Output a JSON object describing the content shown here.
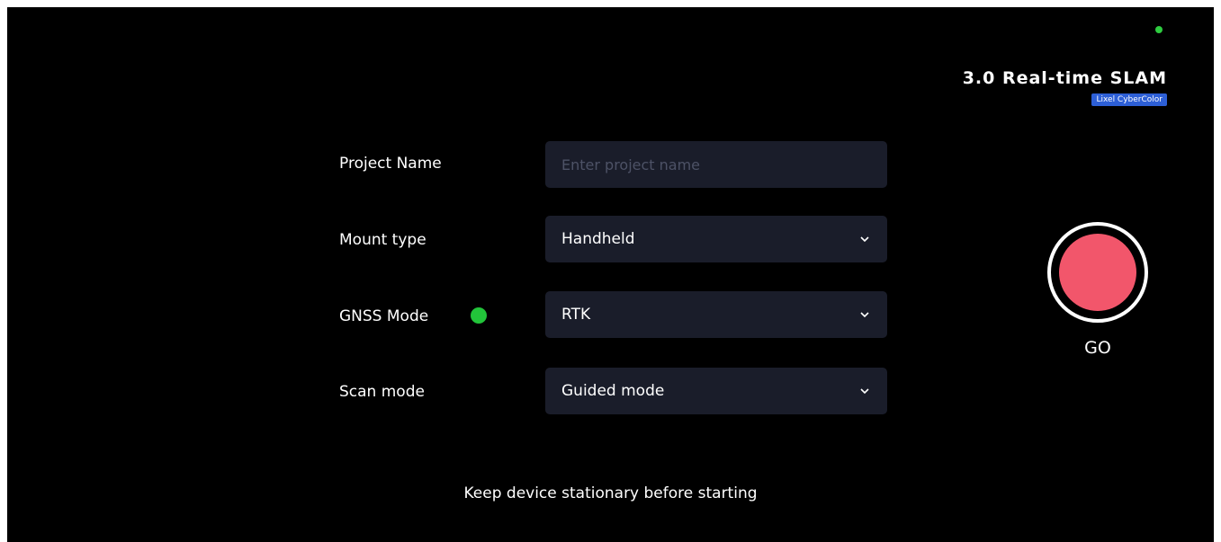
{
  "status": {
    "indicator_color": "#2ecc40"
  },
  "brand": {
    "title": "3.0 Real-time SLAM",
    "badge": "Lixel CyberColor",
    "badge_color": "#2d5fd6"
  },
  "form": {
    "project_name": {
      "label": "Project Name",
      "value": "",
      "placeholder": "Enter project name"
    },
    "mount_type": {
      "label": "Mount type",
      "value": "Handheld",
      "icon": "chevron-down-icon"
    },
    "gnss_mode": {
      "label": "GNSS Mode",
      "value": "RTK",
      "status_color": "#22c43a",
      "icon": "chevron-down-icon"
    },
    "scan_mode": {
      "label": "Scan mode",
      "value": "Guided mode",
      "icon": "chevron-down-icon"
    }
  },
  "go": {
    "label": "GO",
    "color": "#f2566b"
  },
  "hint": "Keep device stationary before starting"
}
